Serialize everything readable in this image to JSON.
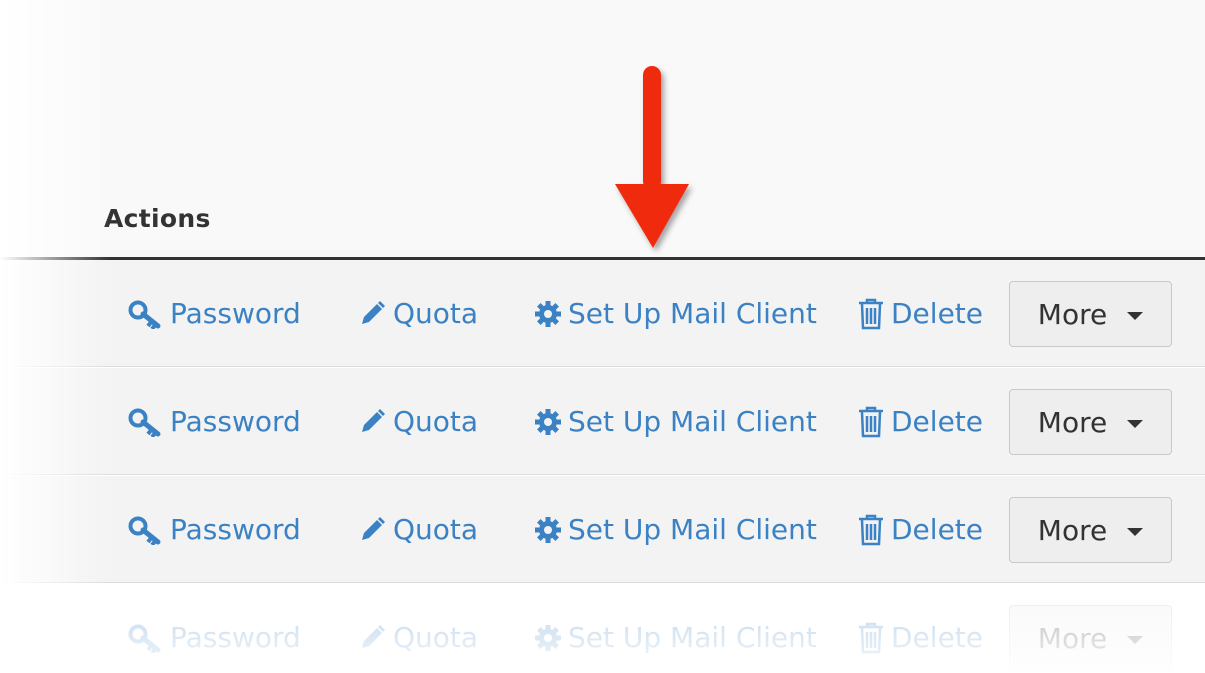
{
  "table": {
    "header": {
      "title": "Actions"
    },
    "rows": [
      {
        "password": "Password",
        "quota": "Quota",
        "setup": "Set Up Mail Client",
        "delete": "Delete",
        "more": "More"
      },
      {
        "password": "Password",
        "quota": "Quota",
        "setup": "Set Up Mail Client",
        "delete": "Delete",
        "more": "More"
      },
      {
        "password": "Password",
        "quota": "Quota",
        "setup": "Set Up Mail Client",
        "delete": "Delete",
        "more": "More"
      },
      {
        "password": "Password",
        "quota": "Quota",
        "setup": "Set Up Mail Client",
        "delete": "Delete",
        "more": "More"
      }
    ]
  },
  "icons": {
    "password": "key-icon",
    "quota": "pencil-icon",
    "setup": "gear-icon",
    "delete": "trash-icon",
    "more": "caret-down-icon"
  },
  "annotation": {
    "pointer": "arrow-down-icon",
    "color": "#f02a0c"
  },
  "colors": {
    "link": "#3b82c4",
    "header_text": "#333333",
    "row_bg": "#f3f3f3"
  }
}
